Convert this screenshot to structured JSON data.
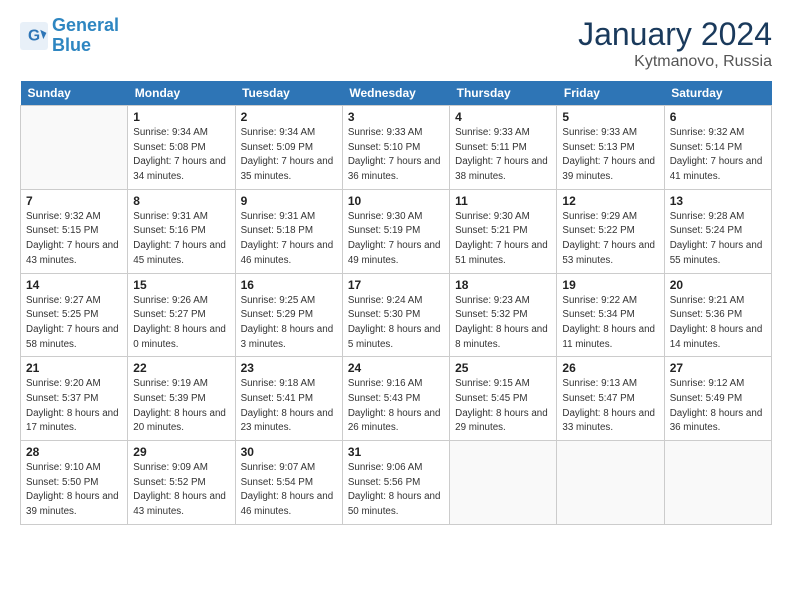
{
  "logo": {
    "line1": "General",
    "line2": "Blue"
  },
  "title": "January 2024",
  "location": "Kytmanovo, Russia",
  "days_header": [
    "Sunday",
    "Monday",
    "Tuesday",
    "Wednesday",
    "Thursday",
    "Friday",
    "Saturday"
  ],
  "weeks": [
    [
      {
        "day": "",
        "sunrise": "",
        "sunset": "",
        "daylight": ""
      },
      {
        "day": "1",
        "sunrise": "Sunrise: 9:34 AM",
        "sunset": "Sunset: 5:08 PM",
        "daylight": "Daylight: 7 hours and 34 minutes."
      },
      {
        "day": "2",
        "sunrise": "Sunrise: 9:34 AM",
        "sunset": "Sunset: 5:09 PM",
        "daylight": "Daylight: 7 hours and 35 minutes."
      },
      {
        "day": "3",
        "sunrise": "Sunrise: 9:33 AM",
        "sunset": "Sunset: 5:10 PM",
        "daylight": "Daylight: 7 hours and 36 minutes."
      },
      {
        "day": "4",
        "sunrise": "Sunrise: 9:33 AM",
        "sunset": "Sunset: 5:11 PM",
        "daylight": "Daylight: 7 hours and 38 minutes."
      },
      {
        "day": "5",
        "sunrise": "Sunrise: 9:33 AM",
        "sunset": "Sunset: 5:13 PM",
        "daylight": "Daylight: 7 hours and 39 minutes."
      },
      {
        "day": "6",
        "sunrise": "Sunrise: 9:32 AM",
        "sunset": "Sunset: 5:14 PM",
        "daylight": "Daylight: 7 hours and 41 minutes."
      }
    ],
    [
      {
        "day": "7",
        "sunrise": "Sunrise: 9:32 AM",
        "sunset": "Sunset: 5:15 PM",
        "daylight": "Daylight: 7 hours and 43 minutes."
      },
      {
        "day": "8",
        "sunrise": "Sunrise: 9:31 AM",
        "sunset": "Sunset: 5:16 PM",
        "daylight": "Daylight: 7 hours and 45 minutes."
      },
      {
        "day": "9",
        "sunrise": "Sunrise: 9:31 AM",
        "sunset": "Sunset: 5:18 PM",
        "daylight": "Daylight: 7 hours and 46 minutes."
      },
      {
        "day": "10",
        "sunrise": "Sunrise: 9:30 AM",
        "sunset": "Sunset: 5:19 PM",
        "daylight": "Daylight: 7 hours and 49 minutes."
      },
      {
        "day": "11",
        "sunrise": "Sunrise: 9:30 AM",
        "sunset": "Sunset: 5:21 PM",
        "daylight": "Daylight: 7 hours and 51 minutes."
      },
      {
        "day": "12",
        "sunrise": "Sunrise: 9:29 AM",
        "sunset": "Sunset: 5:22 PM",
        "daylight": "Daylight: 7 hours and 53 minutes."
      },
      {
        "day": "13",
        "sunrise": "Sunrise: 9:28 AM",
        "sunset": "Sunset: 5:24 PM",
        "daylight": "Daylight: 7 hours and 55 minutes."
      }
    ],
    [
      {
        "day": "14",
        "sunrise": "Sunrise: 9:27 AM",
        "sunset": "Sunset: 5:25 PM",
        "daylight": "Daylight: 7 hours and 58 minutes."
      },
      {
        "day": "15",
        "sunrise": "Sunrise: 9:26 AM",
        "sunset": "Sunset: 5:27 PM",
        "daylight": "Daylight: 8 hours and 0 minutes."
      },
      {
        "day": "16",
        "sunrise": "Sunrise: 9:25 AM",
        "sunset": "Sunset: 5:29 PM",
        "daylight": "Daylight: 8 hours and 3 minutes."
      },
      {
        "day": "17",
        "sunrise": "Sunrise: 9:24 AM",
        "sunset": "Sunset: 5:30 PM",
        "daylight": "Daylight: 8 hours and 5 minutes."
      },
      {
        "day": "18",
        "sunrise": "Sunrise: 9:23 AM",
        "sunset": "Sunset: 5:32 PM",
        "daylight": "Daylight: 8 hours and 8 minutes."
      },
      {
        "day": "19",
        "sunrise": "Sunrise: 9:22 AM",
        "sunset": "Sunset: 5:34 PM",
        "daylight": "Daylight: 8 hours and 11 minutes."
      },
      {
        "day": "20",
        "sunrise": "Sunrise: 9:21 AM",
        "sunset": "Sunset: 5:36 PM",
        "daylight": "Daylight: 8 hours and 14 minutes."
      }
    ],
    [
      {
        "day": "21",
        "sunrise": "Sunrise: 9:20 AM",
        "sunset": "Sunset: 5:37 PM",
        "daylight": "Daylight: 8 hours and 17 minutes."
      },
      {
        "day": "22",
        "sunrise": "Sunrise: 9:19 AM",
        "sunset": "Sunset: 5:39 PM",
        "daylight": "Daylight: 8 hours and 20 minutes."
      },
      {
        "day": "23",
        "sunrise": "Sunrise: 9:18 AM",
        "sunset": "Sunset: 5:41 PM",
        "daylight": "Daylight: 8 hours and 23 minutes."
      },
      {
        "day": "24",
        "sunrise": "Sunrise: 9:16 AM",
        "sunset": "Sunset: 5:43 PM",
        "daylight": "Daylight: 8 hours and 26 minutes."
      },
      {
        "day": "25",
        "sunrise": "Sunrise: 9:15 AM",
        "sunset": "Sunset: 5:45 PM",
        "daylight": "Daylight: 8 hours and 29 minutes."
      },
      {
        "day": "26",
        "sunrise": "Sunrise: 9:13 AM",
        "sunset": "Sunset: 5:47 PM",
        "daylight": "Daylight: 8 hours and 33 minutes."
      },
      {
        "day": "27",
        "sunrise": "Sunrise: 9:12 AM",
        "sunset": "Sunset: 5:49 PM",
        "daylight": "Daylight: 8 hours and 36 minutes."
      }
    ],
    [
      {
        "day": "28",
        "sunrise": "Sunrise: 9:10 AM",
        "sunset": "Sunset: 5:50 PM",
        "daylight": "Daylight: 8 hours and 39 minutes."
      },
      {
        "day": "29",
        "sunrise": "Sunrise: 9:09 AM",
        "sunset": "Sunset: 5:52 PM",
        "daylight": "Daylight: 8 hours and 43 minutes."
      },
      {
        "day": "30",
        "sunrise": "Sunrise: 9:07 AM",
        "sunset": "Sunset: 5:54 PM",
        "daylight": "Daylight: 8 hours and 46 minutes."
      },
      {
        "day": "31",
        "sunrise": "Sunrise: 9:06 AM",
        "sunset": "Sunset: 5:56 PM",
        "daylight": "Daylight: 8 hours and 50 minutes."
      },
      {
        "day": "",
        "sunrise": "",
        "sunset": "",
        "daylight": ""
      },
      {
        "day": "",
        "sunrise": "",
        "sunset": "",
        "daylight": ""
      },
      {
        "day": "",
        "sunrise": "",
        "sunset": "",
        "daylight": ""
      }
    ]
  ]
}
